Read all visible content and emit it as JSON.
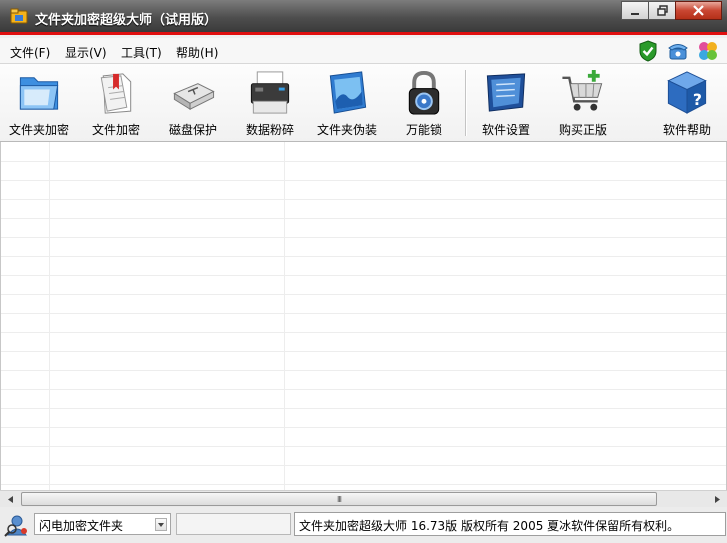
{
  "window": {
    "title": "文件夹加密超级大师（试用版）",
    "accent_color": "#e01010",
    "controls": [
      "minimize-icon",
      "restore-icon",
      "close-icon"
    ]
  },
  "menu": {
    "items": [
      {
        "label": "文件(F)"
      },
      {
        "label": "显示(V)"
      },
      {
        "label": "工具(T)"
      },
      {
        "label": "帮助(H)"
      }
    ],
    "right_icons": [
      "shield-check-icon",
      "telephone-icon",
      "clover-icon"
    ]
  },
  "toolbar": {
    "items": [
      {
        "label": "文件夹加密",
        "icon": "folder-icon"
      },
      {
        "label": "文件加密",
        "icon": "document-icon"
      },
      {
        "label": "磁盘保护",
        "icon": "usb-drive-icon"
      },
      {
        "label": "数据粉碎",
        "icon": "shredder-icon"
      },
      {
        "label": "文件夹伪装",
        "icon": "disguise-folder-icon"
      },
      {
        "label": "万能锁",
        "icon": "padlock-icon"
      },
      {
        "label": "软件设置",
        "icon": "settings-screen-icon"
      },
      {
        "label": "购买正版",
        "icon": "shopping-cart-icon"
      },
      {
        "label": "软件帮助",
        "icon": "help-cube-icon"
      }
    ]
  },
  "statusbar": {
    "combo_value": "闪电加密文件夹",
    "panel_text": "",
    "info_text": "文件夹加密超级大师 16.73版 版权所有 2005 夏冰软件保留所有权利。"
  },
  "scrollbar": {
    "grip": "III"
  }
}
